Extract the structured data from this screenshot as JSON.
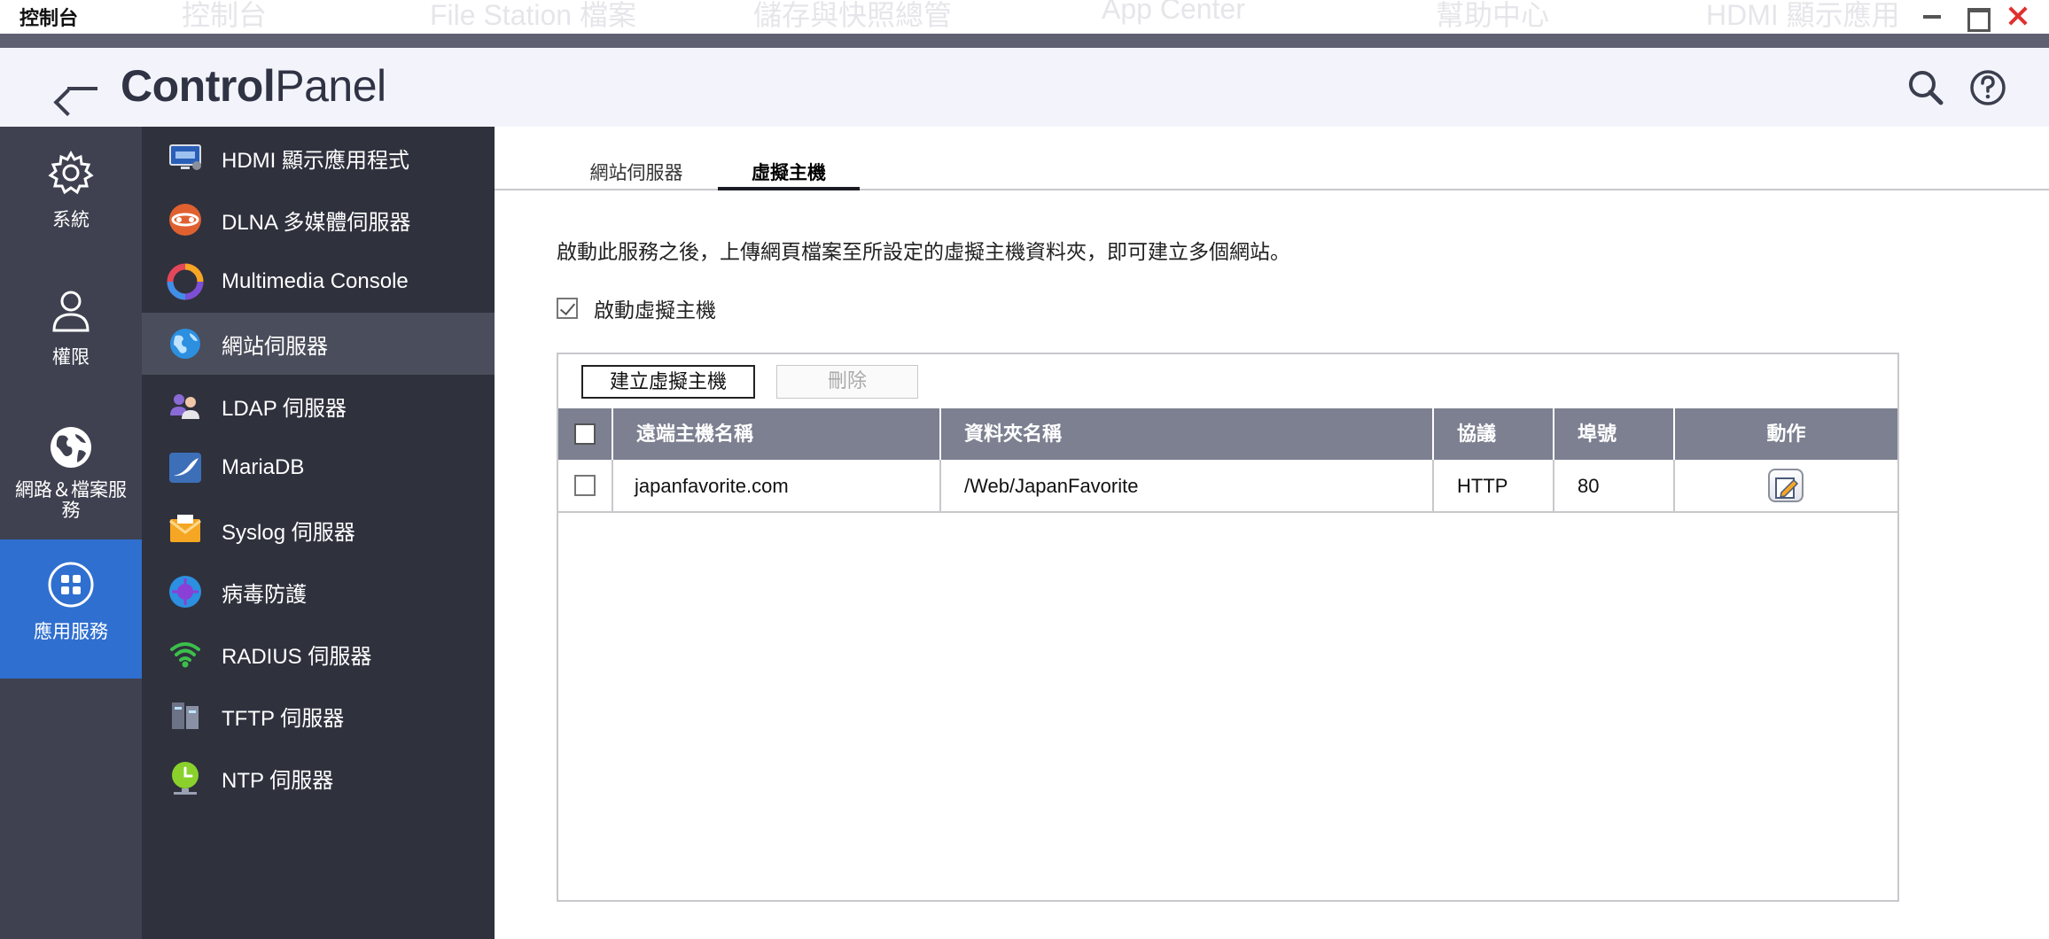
{
  "window": {
    "title": "控制台",
    "ghost_tabs": [
      "控制台",
      "File Station 檔案",
      "儲存與快照總管",
      "App Center",
      "幫助中心",
      "HDMI 顯示應用"
    ]
  },
  "header": {
    "brand_bold": "Control",
    "brand_light": "Panel",
    "icons": [
      "back-arrow-icon",
      "search-icon",
      "help-icon"
    ]
  },
  "rail": {
    "items": [
      {
        "label": "系統",
        "icon": "gear-icon"
      },
      {
        "label": "權限",
        "icon": "user-icon"
      },
      {
        "label": "網路＆檔案服務",
        "icon": "globe-icon"
      },
      {
        "label": "應用服務",
        "icon": "apps-grid-icon",
        "active": true
      }
    ]
  },
  "subnav": {
    "items": [
      {
        "label": "HDMI 顯示應用程式",
        "icon": "hdmi-monitor-icon"
      },
      {
        "label": "DLNA 多媒體伺服器",
        "icon": "dlna-icon"
      },
      {
        "label": "Multimedia Console",
        "icon": "multimedia-ring-icon"
      },
      {
        "label": "網站伺服器",
        "icon": "web-globe-icon",
        "active": true
      },
      {
        "label": "LDAP 伺服器",
        "icon": "ldap-users-icon"
      },
      {
        "label": "MariaDB",
        "icon": "mariadb-icon"
      },
      {
        "label": "Syslog 伺服器",
        "icon": "syslog-envelope-icon"
      },
      {
        "label": "病毒防護",
        "icon": "antivirus-icon"
      },
      {
        "label": "RADIUS 伺服器",
        "icon": "radius-wifi-icon"
      },
      {
        "label": "TFTP 伺服器",
        "icon": "tftp-server-icon"
      },
      {
        "label": "NTP 伺服器",
        "icon": "ntp-clock-icon"
      }
    ]
  },
  "main": {
    "tabs": [
      {
        "label": "網站伺服器"
      },
      {
        "label": "虛擬主機",
        "active": true
      }
    ],
    "description": "啟動此服務之後，上傳網頁檔案至所設定的虛擬主機資料夾，即可建立多個網站。",
    "enable_label": "啟動虛擬主機",
    "enable_checked": true,
    "buttons": {
      "create": "建立虛擬主機",
      "delete": "刪除"
    },
    "table": {
      "columns": [
        "遠端主機名稱",
        "資料夾名稱",
        "協議",
        "埠號",
        "動作"
      ],
      "rows": [
        {
          "host": "japanfavorite.com",
          "folder": "/Web/JapanFavorite",
          "protocol": "HTTP",
          "port": "80"
        }
      ]
    }
  },
  "colors": {
    "rail_bg": "#3f4150",
    "subnav_bg": "#2f313d",
    "active_blue": "#2f6fd0",
    "table_header": "#7c8090",
    "close_red": "#e0312f"
  }
}
